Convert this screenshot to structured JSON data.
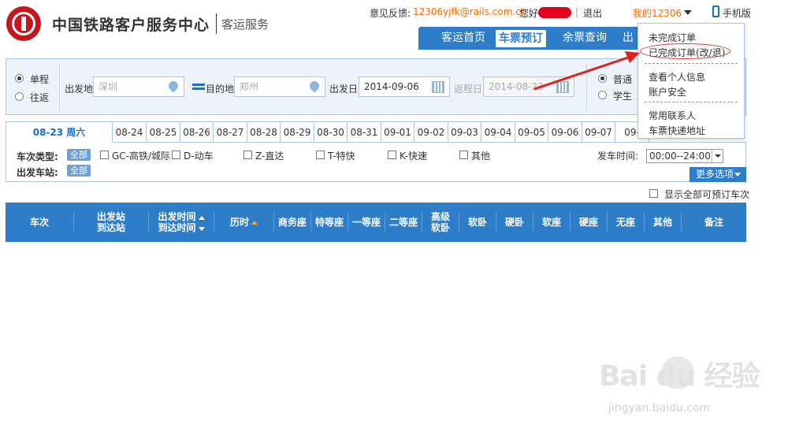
{
  "header": {
    "site_name": "中国铁路客户服务中心",
    "site_sub": "客运服务",
    "feedback_label": "意见反馈:",
    "feedback_email": "12306yjfk@rails.com.cn",
    "hello": "您好",
    "separator": "|",
    "logout": "退出",
    "my12306": "我的12306",
    "mobile": "手机版"
  },
  "nav": {
    "items": [
      "客运首页",
      "车票预订",
      "余票查询",
      "出"
    ]
  },
  "dropdown": {
    "items": [
      "未完成订单",
      "已完成订单(改/退)",
      "查看个人信息",
      "账户安全",
      "常用联系人",
      "车票快递地址"
    ]
  },
  "search": {
    "trip_oneway": "单程",
    "trip_roundtrip": "往返",
    "from_label": "出发地",
    "from_value": "深圳",
    "to_label": "目的地",
    "to_value": "郑州",
    "depart_label": "出发日",
    "depart_value": "2014-09-06",
    "return_label": "返程日",
    "return_value": "2014-08-23",
    "type_normal": "普通",
    "type_student": "学生"
  },
  "dates": {
    "active": "08-23 周六",
    "tabs": [
      "08-24",
      "08-25",
      "08-26",
      "08-27",
      "08-28",
      "08-29",
      "08-30",
      "08-31",
      "09-01",
      "09-02",
      "09-03",
      "09-04",
      "09-05",
      "09-06",
      "09-07",
      "09-"
    ]
  },
  "filters": {
    "train_type_label": "车次类型:",
    "station_label": "出发车站:",
    "all_tag": "全部",
    "types": [
      "GC-高铁/城际",
      "D-动车",
      "Z-直达",
      "T-特快",
      "K-快速",
      "其他"
    ],
    "depart_time_label": "发车时间:",
    "depart_time_value": "00:00--24:00",
    "more_options": "更多选项",
    "show_all": "显示全部可预订车次"
  },
  "table": {
    "headers": {
      "train_no": "车次",
      "station_1": "出发站",
      "station_2": "到达站",
      "time_1": "出发时间",
      "time_2": "到达时间",
      "duration": "历时",
      "business": "商务座",
      "special": "特等座",
      "first": "一等座",
      "second": "二等座",
      "adv_1": "高级",
      "adv_2": "软卧",
      "soft_sleeper": "软卧",
      "hard_sleeper": "硬卧",
      "soft_seat": "软座",
      "hard_seat": "硬座",
      "no_seat": "无座",
      "other": "其他",
      "remark": "备注"
    }
  },
  "watermark": {
    "brand": "Bai du 经验",
    "url": "jingyan.baidu.com"
  },
  "colors": {
    "primary_blue": "#2e7dc8",
    "brand_red": "#c8161d",
    "orange_link": "#ff6600",
    "annotation_red": "#d32f2f"
  }
}
